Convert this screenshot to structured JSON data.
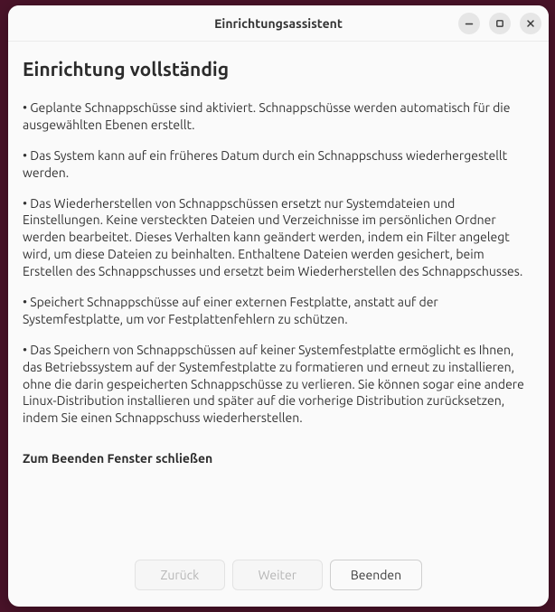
{
  "titlebar": {
    "title": "Einrichtungsassistent"
  },
  "page": {
    "title": "Einrichtung vollständig"
  },
  "paragraphs": [
    "• Geplante Schnappschüsse sind aktiviert. Schnappschüsse werden automatisch für die ausgewählten Ebenen erstellt.",
    "• Das System kann auf ein früheres Datum durch ein Schnappschuss wiederhergestellt werden.",
    "• Das Wiederherstellen von Schnappschüssen ersetzt nur Systemdateien und Einstellungen. Keine versteckten Dateien und Verzeichnisse im persönlichen Ordner werden bearbeitet. Dieses Verhalten kann geändert werden, indem ein Filter angelegt wird, um diese Dateien zu beinhalten. Enthaltene Dateien werden gesichert, beim Erstellen des Schnappschusses und ersetzt beim Wiederherstellen des Schnappschusses.",
    "• Speichert Schnappschüsse auf einer externen Festplatte, anstatt auf der Systemfestplatte, um vor Festplattenfehlern zu schützen.",
    "• Das Speichern von Schnappschüssen auf keiner Systemfestplatte ermöglicht es Ihnen, das Betriebssystem auf der Systemfestplatte zu formatieren und erneut zu installieren, ohne die darin gespeicherten Schnappschüsse zu verlieren. Sie können sogar eine andere Linux-Distribution installieren und später auf die vorherige Distribution zurücksetzen, indem Sie einen Schnappschuss wiederherstellen."
  ],
  "closing": "Zum Beenden Fenster schließen",
  "footer": {
    "back": "Zurück",
    "next": "Weiter",
    "finish": "Beenden"
  }
}
